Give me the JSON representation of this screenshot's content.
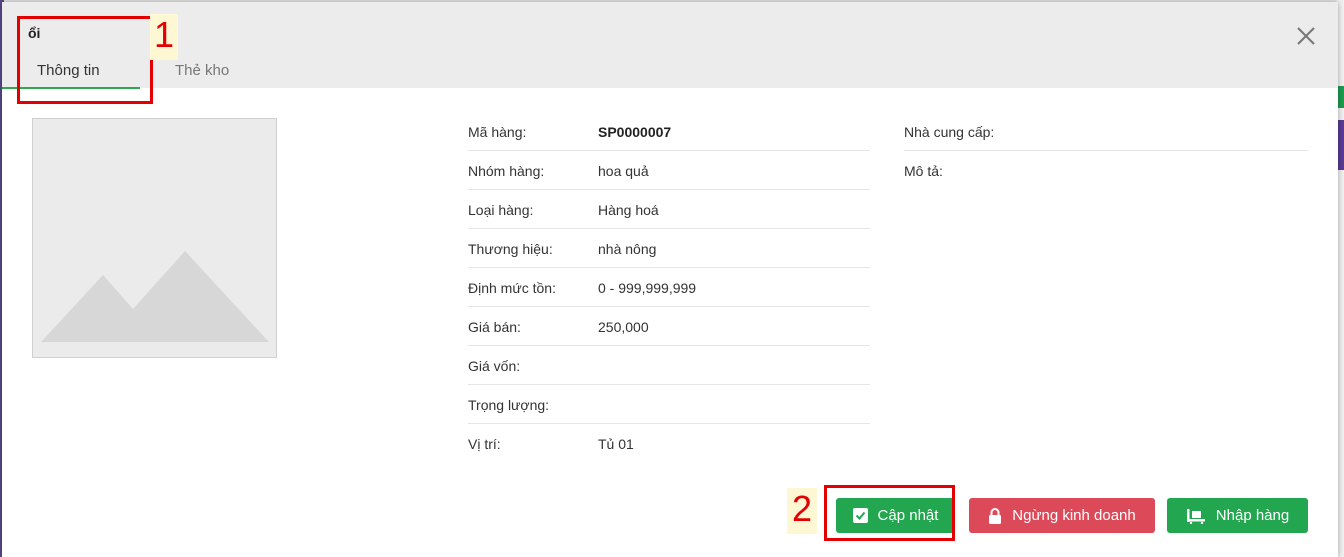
{
  "header": {
    "title": "ổi"
  },
  "tabs": [
    {
      "label": "Thông tin",
      "active": true
    },
    {
      "label": "Thẻ kho",
      "active": false
    }
  ],
  "details": {
    "rows": [
      {
        "label": "Mã hàng:",
        "value": "SP0000007"
      },
      {
        "label": "Nhóm hàng:",
        "value": "hoa quả"
      },
      {
        "label": "Loại hàng:",
        "value": "Hàng hoá"
      },
      {
        "label": "Thương hiệu:",
        "value": "nhà nông"
      },
      {
        "label": "Định mức tồn:",
        "value": "0 - 999,999,999"
      },
      {
        "label": "Giá bán:",
        "value": "250,000"
      },
      {
        "label": "Giá vốn:",
        "value": ""
      },
      {
        "label": "Trọng lượng:",
        "value": ""
      },
      {
        "label": "Vị trí:",
        "value": "Tủ 01"
      }
    ],
    "right_rows": [
      {
        "label": "Nhà cung cấp:"
      },
      {
        "label": "Mô tả:"
      }
    ]
  },
  "buttons": {
    "update": "Cập nhật",
    "stop": "Ngừng kinh doanh",
    "import": "Nhập hàng"
  },
  "annotations": {
    "one": "1",
    "two": "2"
  },
  "colors": {
    "accent_green": "#22a64f",
    "danger_red": "#dc4a5a",
    "annotation_red": "#e40000"
  }
}
